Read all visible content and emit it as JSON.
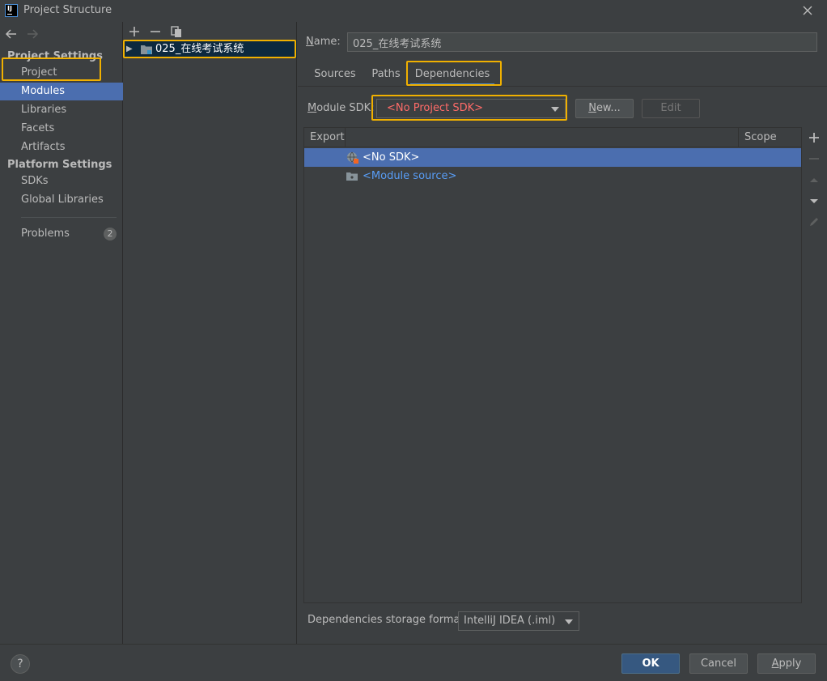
{
  "window": {
    "title": "Project Structure",
    "icon_text": "IJ"
  },
  "sidebar": {
    "project_settings_header": "Project Settings",
    "platform_settings_header": "Platform Settings",
    "items": [
      {
        "label": "Project"
      },
      {
        "label": "Modules",
        "selected": true
      },
      {
        "label": "Libraries"
      },
      {
        "label": "Facets"
      },
      {
        "label": "Artifacts"
      }
    ],
    "platform_items": [
      {
        "label": "SDKs"
      },
      {
        "label": "Global Libraries"
      }
    ],
    "problems": {
      "label": "Problems",
      "count": "2"
    }
  },
  "module_tree": {
    "items": [
      {
        "label": "025_在线考试系统"
      }
    ]
  },
  "details": {
    "name_label": "Name:",
    "name_value": "025_在线考试系统",
    "tabs": [
      {
        "label": "Sources"
      },
      {
        "label": "Paths"
      },
      {
        "label": "Dependencies",
        "active": true
      }
    ],
    "module_sdk_label": "Module SDK:",
    "module_sdk_value": "<No Project SDK>",
    "new_button": "New...",
    "edit_button": "Edit",
    "table": {
      "col_export": "Export",
      "col_scope": "Scope",
      "rows": [
        {
          "label": "<No SDK>",
          "icon": "sdk-globe-icon",
          "color": "#ffffff"
        },
        {
          "label": "<Module source>",
          "icon": "folder-icon",
          "color": "#589df6"
        }
      ]
    },
    "storage_format_label": "Dependencies storage format:",
    "storage_format_value": "IntelliJ IDEA (.iml)"
  },
  "footer": {
    "help": "?",
    "ok": "OK",
    "cancel": "Cancel",
    "apply": "Apply"
  },
  "colors": {
    "selection": "#4b6eaf",
    "highlight_box": "#f0b000",
    "error_text": "#ff6b68",
    "link_text": "#589df6"
  }
}
